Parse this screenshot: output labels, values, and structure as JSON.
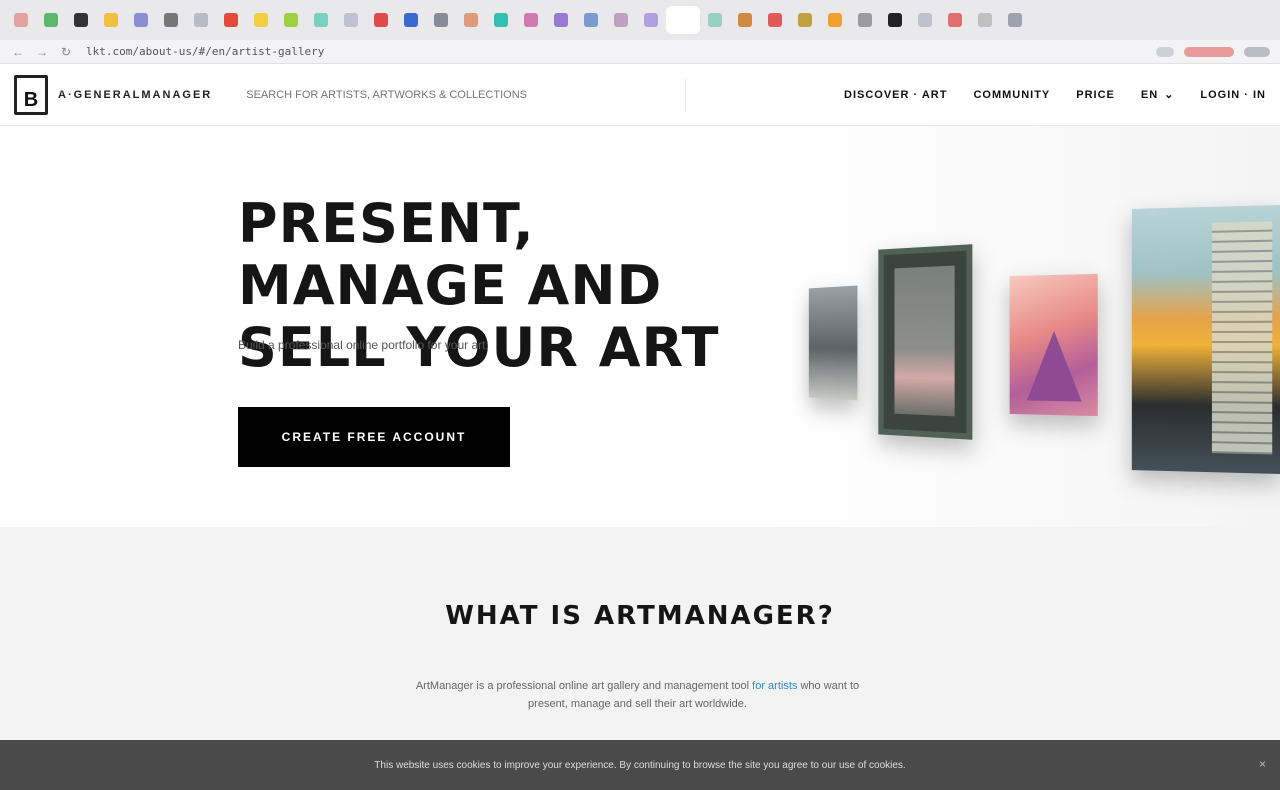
{
  "browser": {
    "tab_favicon_colors": [
      "#e2a0a0",
      "#59b86a",
      "#333333",
      "#f0c040",
      "#8a8fd0",
      "#777777",
      "#b9b9c8",
      "#e34a3a",
      "#f0d040",
      "#9fd040",
      "#7ad0c0",
      "#c0c0d0",
      "#e04a4a",
      "#3a6ad0",
      "#8a8a9a",
      "#e09a7a",
      "#30c0b0",
      "#d07ab0",
      "#9a7ad0",
      "#7a9ad0",
      "#c0a0c0",
      "#b0a0e0",
      "#ffffff",
      "#9ad0c0",
      "#d08a40",
      "#e05a5a",
      "#c0a040",
      "#f0a030",
      "#9a9aa0",
      "#222222",
      "#c0c0d0",
      "#e07070",
      "#c0c0c0",
      "#a0a0b0"
    ],
    "url": "lkt.com/about-us/#/en/artist-gallery",
    "back_icon": "arrow-left-icon",
    "forward_icon": "arrow-right-icon",
    "reload_icon": "reload-icon"
  },
  "header": {
    "logo_letter": "B",
    "brand": "A·GENERALMANAGER",
    "search_placeholder": "SEARCH FOR ARTISTS, ARTWORKS & COLLECTIONS",
    "nav": {
      "item1": "DISCOVER · ART",
      "item2": "COMMUNITY",
      "item3": "PRICE",
      "lang": "EN",
      "login": "LOGIN · IN"
    }
  },
  "hero": {
    "title": "PRESENT, MANAGE AND SELL YOUR ART",
    "subtitle": "Build a professional online portfolio for your art.",
    "cta": "CREATE FREE ACCOUNT"
  },
  "section2": {
    "title": "WHAT IS ARTMANAGER?",
    "text_prefix": "ArtManager is a professional online art gallery and management tool",
    "link": "for artists",
    "text_suffix": "who want to present, manage and sell their art worldwide."
  },
  "cookie": {
    "text": "This website uses cookies to improve your experience. By continuing to browse the site you agree to our use of cookies.",
    "close": "×"
  }
}
